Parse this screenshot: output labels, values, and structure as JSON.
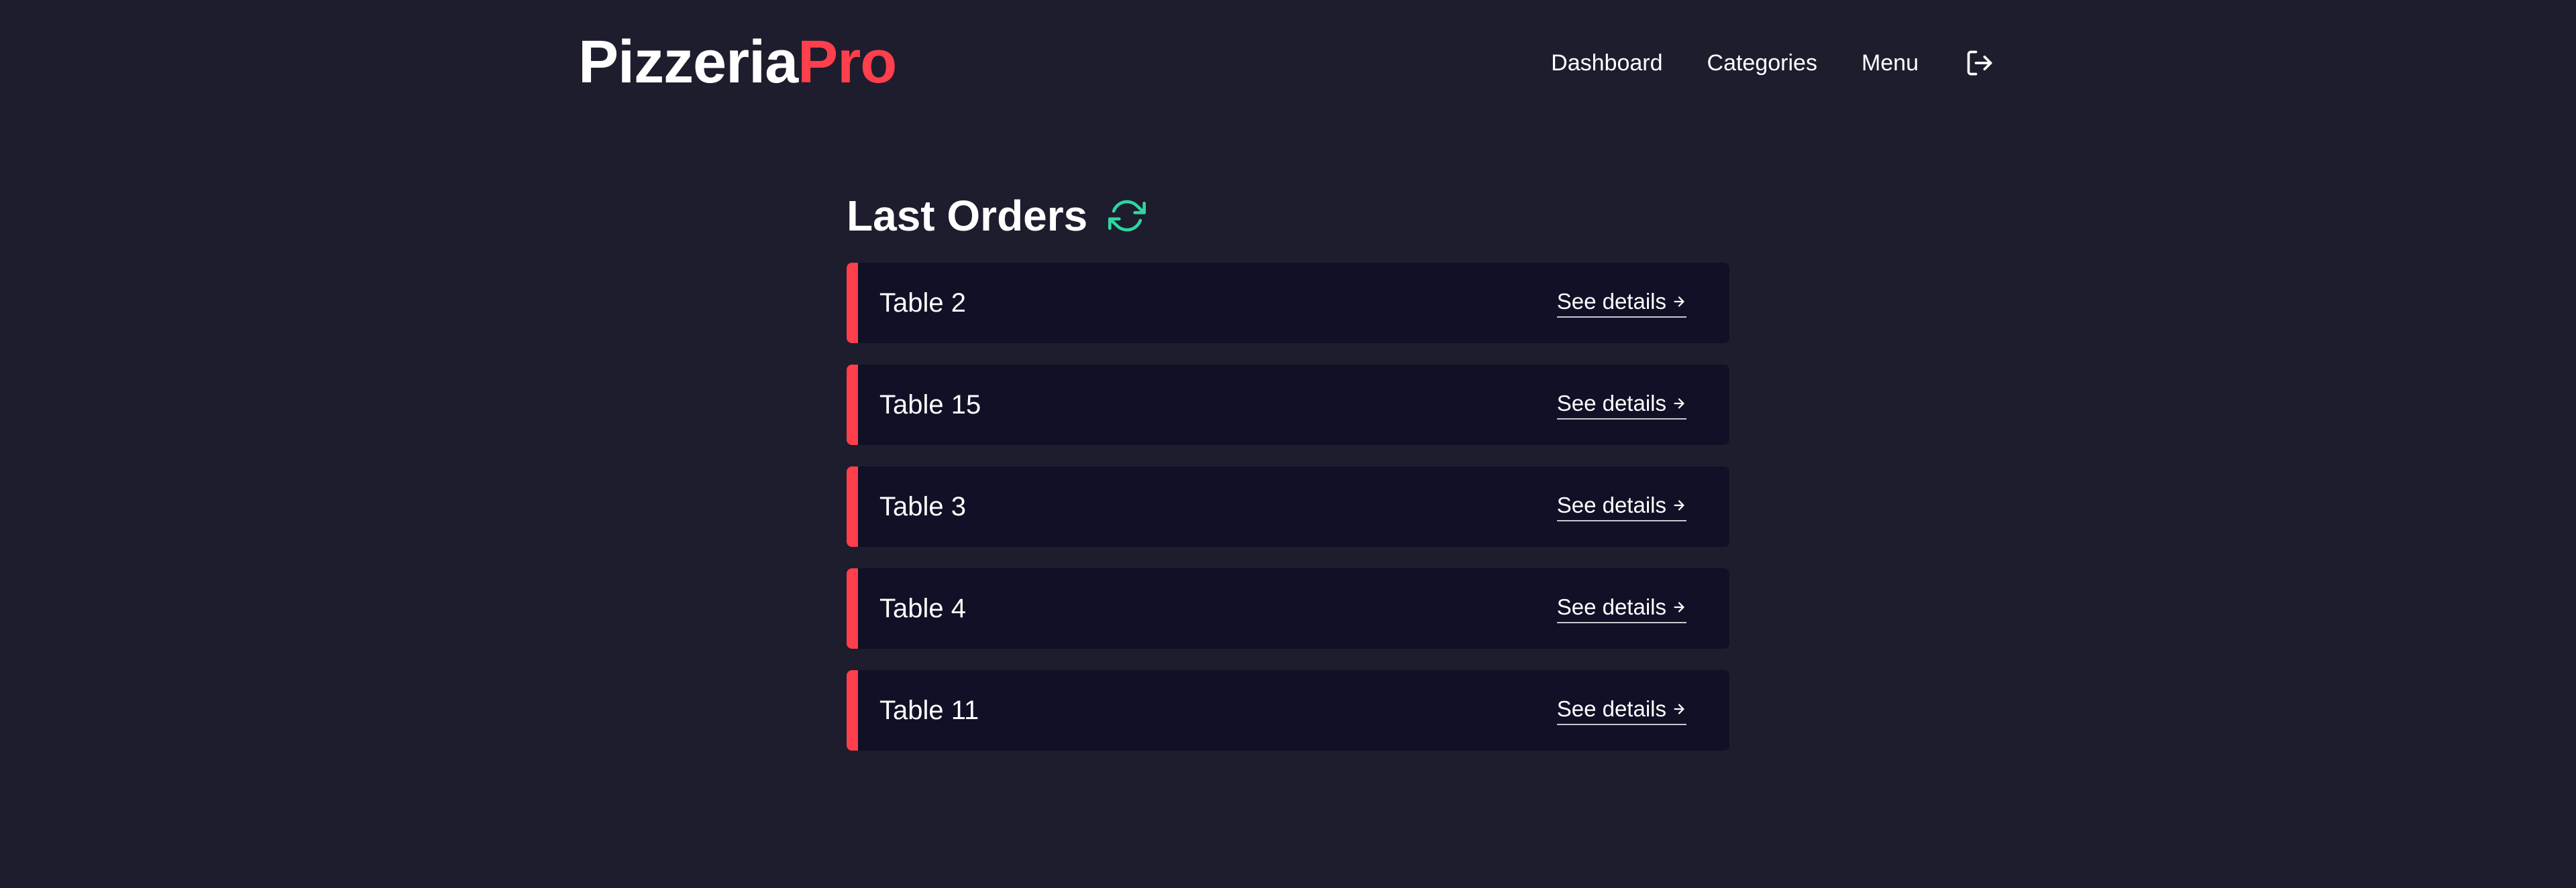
{
  "brand": {
    "name_primary": "Pizzeria",
    "name_accent": "Pro",
    "accent_color": "#ff3f4b"
  },
  "nav": {
    "items": [
      {
        "label": "Dashboard"
      },
      {
        "label": "Categories"
      },
      {
        "label": "Menu"
      }
    ],
    "logout_icon": "logout-icon"
  },
  "main": {
    "title": "Last Orders",
    "refresh_icon": "refresh-icon",
    "refresh_color": "#2fd6a0",
    "orders": [
      {
        "name": "Table 2",
        "link": "See details"
      },
      {
        "name": "Table 15",
        "link": "See details"
      },
      {
        "name": "Table 3",
        "link": "See details"
      },
      {
        "name": "Table 4",
        "link": "See details"
      },
      {
        "name": "Table 11",
        "link": "See details"
      }
    ]
  },
  "colors": {
    "background": "#1d1d2e",
    "card": "#101026",
    "accent": "#ff3f4b",
    "refresh": "#2fd6a0"
  }
}
